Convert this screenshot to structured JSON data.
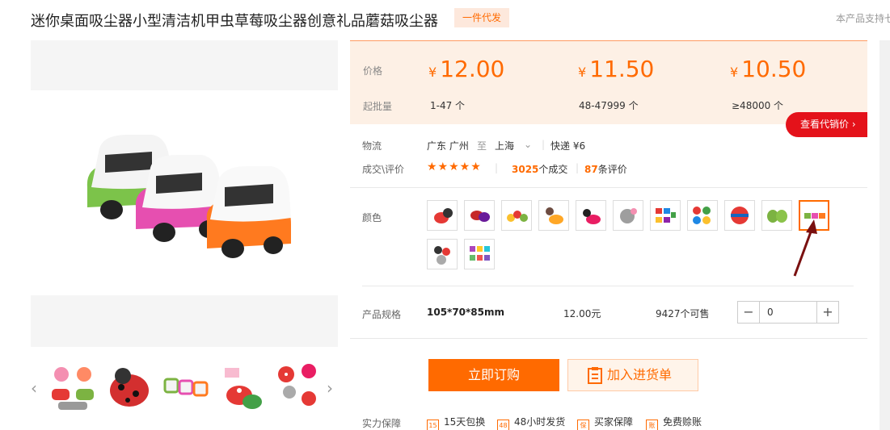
{
  "title": "迷你桌面吸尘器小型清洁机甲虫草莓吸尘器创意礼品蘑菇吸尘器",
  "tag": "一件代发",
  "support_text": "本产品支持七",
  "price_panel": {
    "price_label": "价格",
    "batch_label": "起批量",
    "currency": "¥",
    "tiers": [
      {
        "price": "12.00",
        "range": "1-47 个"
      },
      {
        "price": "11.50",
        "range": "48-47999 个"
      },
      {
        "price": "10.50",
        "range": "≥48000 个"
      }
    ],
    "agent_button": "查看代销价 ›"
  },
  "logistics": {
    "label": "物流",
    "from": "广东 广州",
    "to_word": "至",
    "to": "上海",
    "express": "快递 ¥6"
  },
  "deals": {
    "label": "成交\\评价",
    "stars": "★★★★★",
    "count": "3025",
    "count_suffix": "个成交",
    "reviews": "87",
    "reviews_suffix": "条评价"
  },
  "color": {
    "label": "颜色",
    "swatch_icons": [
      "ladybug-icon",
      "beetle-icon",
      "mushroom-icon",
      "strawberry-icon",
      "panda-icon",
      "robot-icon",
      "mini-bus-icon",
      "frog-icon",
      "ball-icon",
      "green-frog-icon",
      "car-icon",
      "bug-icon",
      "colorful-icon"
    ],
    "selected_index": 10
  },
  "spec": {
    "label": "产品规格",
    "size": "105*70*85mm",
    "price": "12.00元",
    "stock": "9427个可售",
    "minus": "−",
    "qty": "0",
    "plus": "+"
  },
  "buttons": {
    "buy": "立即订购",
    "cart": "加入进货单"
  },
  "guarantee": {
    "label": "实力保障",
    "items": [
      {
        "icon": "15",
        "text": "15天包换"
      },
      {
        "icon": "48",
        "text": "48小时发货"
      },
      {
        "icon": "保",
        "text": "买家保障"
      },
      {
        "icon": "账",
        "text": "免费赊账"
      }
    ]
  },
  "gallery": {
    "prev": "‹",
    "next": "›"
  }
}
